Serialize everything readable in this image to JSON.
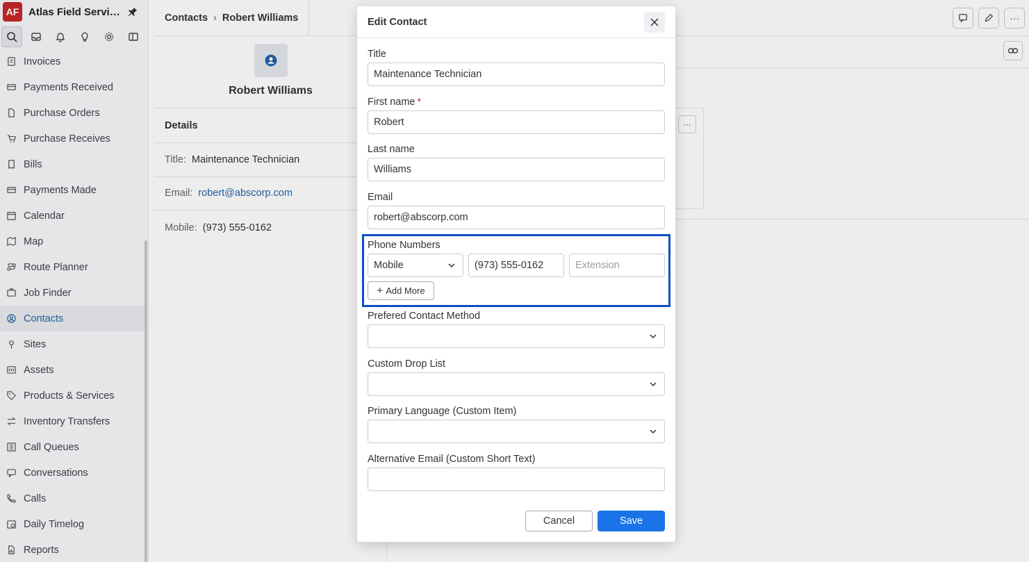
{
  "app": {
    "logo": "AF",
    "name": "Atlas Field Servic..."
  },
  "sidebar": {
    "items": [
      {
        "label": "Invoices",
        "icon": "invoice-icon"
      },
      {
        "label": "Payments Received",
        "icon": "card-icon"
      },
      {
        "label": "Purchase Orders",
        "icon": "document-icon"
      },
      {
        "label": "Purchase Receives",
        "icon": "cart-icon"
      },
      {
        "label": "Bills",
        "icon": "bill-icon"
      },
      {
        "label": "Payments Made",
        "icon": "card-icon"
      },
      {
        "label": "Calendar",
        "icon": "calendar-icon"
      },
      {
        "label": "Map",
        "icon": "map-icon"
      },
      {
        "label": "Route Planner",
        "icon": "route-icon"
      },
      {
        "label": "Job Finder",
        "icon": "job-finder-icon"
      },
      {
        "label": "Contacts",
        "icon": "contact-icon",
        "active": true
      },
      {
        "label": "Sites",
        "icon": "pin-icon"
      },
      {
        "label": "Assets",
        "icon": "asset-icon"
      },
      {
        "label": "Products & Services",
        "icon": "tag-icon"
      },
      {
        "label": "Inventory Transfers",
        "icon": "transfer-icon"
      },
      {
        "label": "Call Queues",
        "icon": "queue-icon"
      },
      {
        "label": "Conversations",
        "icon": "chat-icon"
      },
      {
        "label": "Calls",
        "icon": "phone-icon"
      },
      {
        "label": "Daily Timelog",
        "icon": "timelog-icon"
      },
      {
        "label": "Reports",
        "icon": "report-icon"
      }
    ]
  },
  "breadcrumb": {
    "root": "Contacts",
    "current": "Robert Williams"
  },
  "contact": {
    "name": "Robert Williams",
    "details_heading": "Details",
    "title_label": "Title:",
    "title_value": "Maintenance Technician",
    "email_label": "Email:",
    "email_value": "robert@abscorp.com",
    "mobile_label": "Mobile:",
    "mobile_value": "(973) 555-0162"
  },
  "modal": {
    "title": "Edit Contact",
    "fields": {
      "title_label": "Title",
      "title_value": "Maintenance Technician",
      "first_label": "First name",
      "required_mark": "*",
      "first_value": "Robert",
      "last_label": "Last name",
      "last_value": "Williams",
      "email_label": "Email",
      "email_value": "robert@abscorp.com",
      "phones_label": "Phone Numbers",
      "phone_type": "Mobile",
      "phone_value": "(973) 555-0162",
      "extension_placeholder": "Extension",
      "add_more": "Add More",
      "preferred_label": "Prefered Contact Method",
      "preferred_value": "",
      "dropdown_label": "Custom Drop List",
      "dropdown_value": "",
      "language_label": "Primary Language (Custom Item)",
      "language_value": "",
      "alt_email_label": "Alternative Email (Custom Short Text)",
      "alt_email_value": ""
    },
    "cancel": "Cancel",
    "save": "Save"
  },
  "colors": {
    "accent": "#1a73e8",
    "highlight": "#0a4fc4",
    "logo": "#c62828",
    "link": "#2463a9"
  }
}
